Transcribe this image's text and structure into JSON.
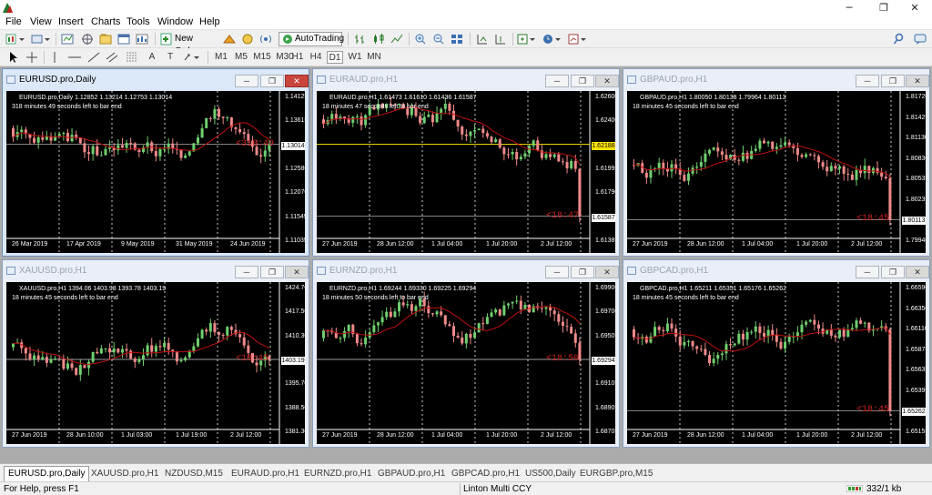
{
  "window": {
    "minimize": "─",
    "restore": "❐",
    "close": "✕"
  },
  "menu": [
    "File",
    "View",
    "Insert",
    "Charts",
    "Tools",
    "Window",
    "Help"
  ],
  "toolbar": {
    "new_order": "New Order",
    "autotrading": "AutoTrading",
    "timeframes": [
      "M1",
      "M5",
      "M15",
      "M30",
      "H1",
      "H4",
      "D1",
      "W1",
      "MN"
    ],
    "drawing_labels": [
      "A",
      "T"
    ]
  },
  "charts": [
    {
      "title": "EURUSD.pro,Daily",
      "ohlc": "EURUSD.pro,Daily  1.12852 1.13214 1.12753 1.13014",
      "left": "318 minutes 49 seconds left to bar end",
      "timer": "<310:49",
      "y_labels": [
        "1.14125",
        "1.13615",
        "1.13014",
        "1.12580",
        "1.12070",
        "1.11545",
        "1.11035"
      ],
      "current": "1.13014",
      "x_labels": [
        "26 Mar 2019",
        "17 Apr 2019",
        "9 May 2019",
        "31 May 2019",
        "24 Jun 2019"
      ],
      "highlight": false
    },
    {
      "title": "EURAUD.pro,H1",
      "ohlc": "EURAUD.pro,H1  1.61473 1.61610 1.61436 1.61587",
      "left": "18 minutes 47 seconds left to bar end",
      "timer": "<18:47",
      "y_labels": [
        "1.62600",
        "1.62400",
        "1.62188",
        "1.61995",
        "1.61790",
        "1.61587",
        "1.61385"
      ],
      "current": "1.61587",
      "x_labels": [
        "27 Jun 2019",
        "28 Jun 12:00",
        "1 Jul 04:00",
        "1 Jul 20:00",
        "2 Jul 12:00"
      ],
      "highlight": "1.62188"
    },
    {
      "title": "GBPAUD.pro,H1",
      "ohlc": "GBPAUD.pro,H1  1.80050 1.80138 1.79964 1.80113",
      "left": "18 minutes 45 seconds left to bar end",
      "timer": "<18:45",
      "y_labels": [
        "1.81720",
        "1.81425",
        "1.81130",
        "1.80830",
        "1.80535",
        "1.80235",
        "1.80113",
        "1.79940"
      ],
      "current": "1.80113",
      "x_labels": [
        "27 Jun 2019",
        "28 Jun 12:00",
        "1 Jul 04:00",
        "1 Jul 20:00",
        "2 Jul 12:00"
      ],
      "highlight": false
    },
    {
      "title": "XAUUSD.pro,H1",
      "ohlc": "XAUUSD.pro,H1  1394.06 1403.98 1393.78 1403.19",
      "left": "18 minutes 45 seconds left to bar end",
      "timer": "<18:45",
      "y_labels": [
        "1424.70",
        "1417.50",
        "1410.30",
        "1403.19",
        "1395.70",
        "1388.50",
        "1381.30"
      ],
      "current": "1403.19",
      "x_labels": [
        "27 Jun 2019",
        "28 Jun 10:00",
        "1 Jul 03:00",
        "1 Jul 19:00",
        "2 Jul 12:00"
      ],
      "highlight": false
    },
    {
      "title": "EURNZD.pro,H1",
      "ohlc": "EURNZD.pro,H1  1.69244 1.69330 1.69225 1.69294",
      "left": "18 minutes 50 seconds left to bar end",
      "timer": "<18:50",
      "y_labels": [
        "1.69900",
        "1.69700",
        "1.69505",
        "1.69294",
        "1.69105",
        "1.68905",
        "1.68705"
      ],
      "current": "1.69294",
      "x_labels": [
        "27 Jun 2019",
        "28 Jun 12:00",
        "1 Jul 04:00",
        "1 Jul 20:00",
        "2 Jul 12:00"
      ],
      "highlight": false
    },
    {
      "title": "GBPCAD.pro,H1",
      "ohlc": "GBPCAD.pro,H1  1.65211 1.65351 1.65176 1.65262",
      "left": "18 minutes 45 seconds left to bar end",
      "timer": "<18:45",
      "y_labels": [
        "1.66590",
        "1.66350",
        "1.66110",
        "1.65875",
        "1.65635",
        "1.65395",
        "1.65262",
        "1.65155"
      ],
      "current": "1.65262",
      "x_labels": [
        "27 Jun 2019",
        "28 Jun 12:00",
        "1 Jul 04:00",
        "1 Jul 20:00",
        "2 Jul 12:00"
      ],
      "highlight": false
    }
  ],
  "tabs": [
    "EURUSD.pro,Daily",
    "XAUUSD.pro,H1",
    "NZDUSD,M15",
    "EURAUD.pro,H1",
    "EURNZD.pro,H1",
    "GBPAUD.pro,H1",
    "GBPCAD.pro,H1",
    "US500,Daily",
    "EURGBP.pro,M15"
  ],
  "status": {
    "help": "For Help, press F1",
    "profile": "Linton Multi CCY",
    "traffic": "332/1 kb"
  },
  "colors": {
    "bull": "#6fcf6f",
    "bear": "#f08a8a",
    "ma": "#c01010",
    "grid": "#ffffff",
    "highlight": "#ffe400"
  },
  "chart_data": [
    {
      "type": "candlestick",
      "symbol": "EURUSD.pro",
      "timeframe": "Daily",
      "y_ticks": [
        1.14125,
        1.13615,
        1.13014,
        1.1258,
        1.1207,
        1.11545,
        1.11035
      ],
      "x_ticks": [
        "26 Mar 2019",
        "17 Apr 2019",
        "9 May 2019",
        "31 May 2019",
        "24 Jun 2019"
      ],
      "last_bar": {
        "open": 1.12852,
        "high": 1.13214,
        "low": 1.12753,
        "close": 1.13014
      },
      "current_price": 1.13014
    },
    {
      "type": "candlestick",
      "symbol": "EURAUD.pro",
      "timeframe": "H1",
      "y_ticks": [
        1.626,
        1.624,
        1.62188,
        1.61995,
        1.6179,
        1.61587,
        1.61385
      ],
      "x_ticks": [
        "27 Jun 2019",
        "28 Jun 12:00",
        "1 Jul 04:00",
        "1 Jul 20:00",
        "2 Jul 12:00"
      ],
      "last_bar": {
        "open": 1.61473,
        "high": 1.6161,
        "low": 1.61436,
        "close": 1.61587
      },
      "current_price": 1.61587,
      "level_line": 1.62188
    },
    {
      "type": "candlestick",
      "symbol": "GBPAUD.pro",
      "timeframe": "H1",
      "y_ticks": [
        1.8172,
        1.81425,
        1.8113,
        1.8083,
        1.80535,
        1.80235,
        1.80113,
        1.7994
      ],
      "x_ticks": [
        "27 Jun 2019",
        "28 Jun 12:00",
        "1 Jul 04:00",
        "1 Jul 20:00",
        "2 Jul 12:00"
      ],
      "last_bar": {
        "open": 1.8005,
        "high": 1.80138,
        "low": 1.79964,
        "close": 1.80113
      },
      "current_price": 1.80113
    },
    {
      "type": "candlestick",
      "symbol": "XAUUSD.pro",
      "timeframe": "H1",
      "y_ticks": [
        1424.7,
        1417.5,
        1410.3,
        1403.19,
        1395.7,
        1388.5,
        1381.3
      ],
      "x_ticks": [
        "27 Jun 2019",
        "28 Jun 10:00",
        "1 Jul 03:00",
        "1 Jul 19:00",
        "2 Jul 12:00"
      ],
      "last_bar": {
        "open": 1394.06,
        "high": 1403.98,
        "low": 1393.78,
        "close": 1403.19
      },
      "current_price": 1403.19
    },
    {
      "type": "candlestick",
      "symbol": "EURNZD.pro",
      "timeframe": "H1",
      "y_ticks": [
        1.699,
        1.697,
        1.69505,
        1.69294,
        1.69105,
        1.68905,
        1.68705
      ],
      "x_ticks": [
        "27 Jun 2019",
        "28 Jun 12:00",
        "1 Jul 04:00",
        "1 Jul 20:00",
        "2 Jul 12:00"
      ],
      "last_bar": {
        "open": 1.69244,
        "high": 1.6933,
        "low": 1.69225,
        "close": 1.69294
      },
      "current_price": 1.69294
    },
    {
      "type": "candlestick",
      "symbol": "GBPCAD.pro",
      "timeframe": "H1",
      "y_ticks": [
        1.6659,
        1.6635,
        1.6611,
        1.65875,
        1.65635,
        1.65395,
        1.65262,
        1.65155
      ],
      "x_ticks": [
        "27 Jun 2019",
        "28 Jun 12:00",
        "1 Jul 04:00",
        "1 Jul 20:00",
        "2 Jul 12:00"
      ],
      "last_bar": {
        "open": 1.65211,
        "high": 1.65351,
        "low": 1.65176,
        "close": 1.65262
      },
      "current_price": 1.65262
    }
  ]
}
